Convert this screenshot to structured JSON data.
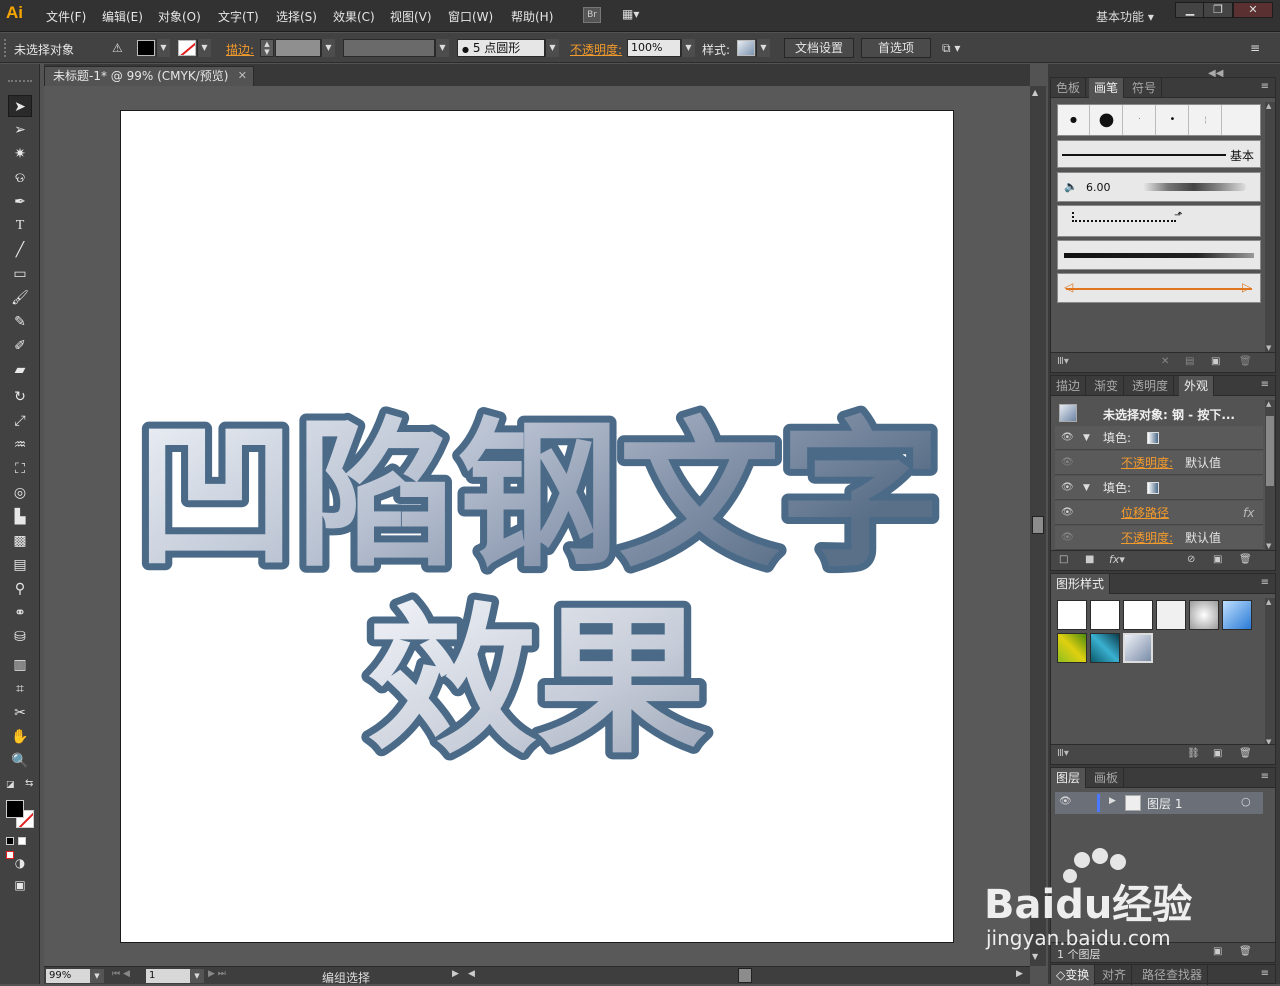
{
  "app": {
    "logo": "Ai"
  },
  "menu": [
    "文件(F)",
    "编辑(E)",
    "对象(O)",
    "文字(T)",
    "选择(S)",
    "效果(C)",
    "视图(V)",
    "窗口(W)",
    "帮助(H)"
  ],
  "bridge_label": "Br",
  "workspace": "基本功能",
  "control": {
    "selection": "未选择对象",
    "stroke_label": "描边:",
    "brush_point": "5 点圆形",
    "opacity_label": "不透明度:",
    "opacity_value": "100%",
    "style_label": "样式:",
    "doc_setup": "文档设置",
    "preferences": "首选项"
  },
  "doc_tab": "未标题-1* @ 99% (CMYK/预览)",
  "artwork": {
    "line1": "凹陷钢文字",
    "line2": "效果"
  },
  "colors": {
    "accent": "#f39a2c",
    "logo": "#f7a600",
    "steel_dark": "#4a6a88",
    "steel_light": "#eef1f6"
  },
  "brushes_panel": {
    "tabs": [
      "色板",
      "画笔",
      "符号"
    ],
    "basic_label": "基本",
    "size_value": "6.00"
  },
  "appearance_panel": {
    "tabs": [
      "描边",
      "渐变",
      "透明度",
      "外观"
    ],
    "header": "未选择对象: 钢 - 按下...",
    "rows": [
      {
        "label": "填色:",
        "type": "fill"
      },
      {
        "label": "不透明度:",
        "value": "默认值",
        "type": "opacity"
      },
      {
        "label": "填色:",
        "type": "fill"
      },
      {
        "label": "位移路径",
        "type": "effect"
      },
      {
        "label": "不透明度:",
        "value": "默认值",
        "type": "opacity"
      }
    ]
  },
  "graphic_styles_panel": {
    "tabs": [
      "图形样式"
    ]
  },
  "layers_panel": {
    "tabs": [
      "图层",
      "画板"
    ],
    "layer_name": "图层 1",
    "count": "1 个图层"
  },
  "bottom_tabs": [
    "变换",
    "对齐",
    "路径查找器"
  ],
  "status": {
    "zoom": "99%",
    "page": "1",
    "status_text": "编组选择"
  },
  "watermark": {
    "brand": "Baidu经验",
    "url": "jingyan.baidu.com"
  }
}
